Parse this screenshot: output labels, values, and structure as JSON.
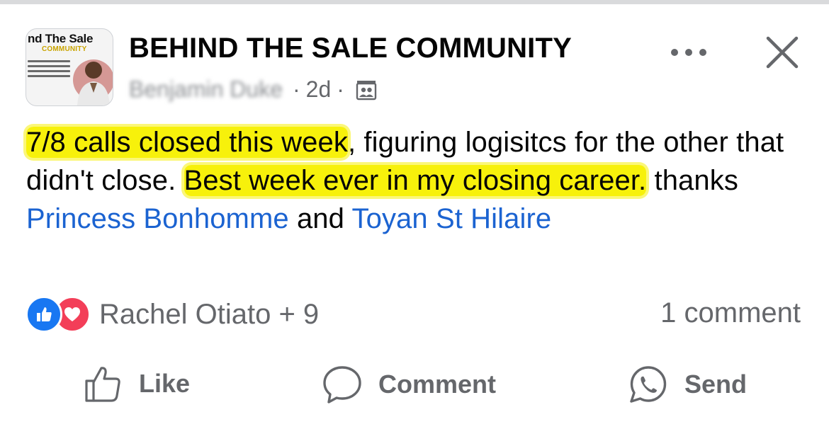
{
  "header": {
    "group_name": "BEHIND THE SALE COMMUNITY",
    "author": "Benjamin Duke",
    "time": "2d",
    "separator": "·",
    "avatar_brand_line1": "nd The Sale",
    "avatar_brand_line2": "COMMUNITY",
    "icons": {
      "more": "more-dots-icon",
      "close": "close-icon",
      "audience": "group-audience-icon"
    }
  },
  "post": {
    "hl1": "7/8 calls closed this week",
    "t1": ", figuring logisitcs for the other that didn't close. ",
    "hl2": "Best week ever in my closing career.",
    "t2": " thanks ",
    "mention1": "Princess Bonhomme",
    "t3": " and ",
    "mention2": "Toyan St Hilaire"
  },
  "reactions": {
    "summary": "Rachel Otiato + 9",
    "comments": "1 comment",
    "types": [
      "like",
      "love"
    ]
  },
  "actions": {
    "like": "Like",
    "comment": "Comment",
    "send": "Send"
  },
  "colors": {
    "highlight": "#f7f10b",
    "mention": "#1b63d1",
    "like_blue": "#1877f2",
    "love_red": "#f33e58",
    "muted_text": "#65676b"
  }
}
